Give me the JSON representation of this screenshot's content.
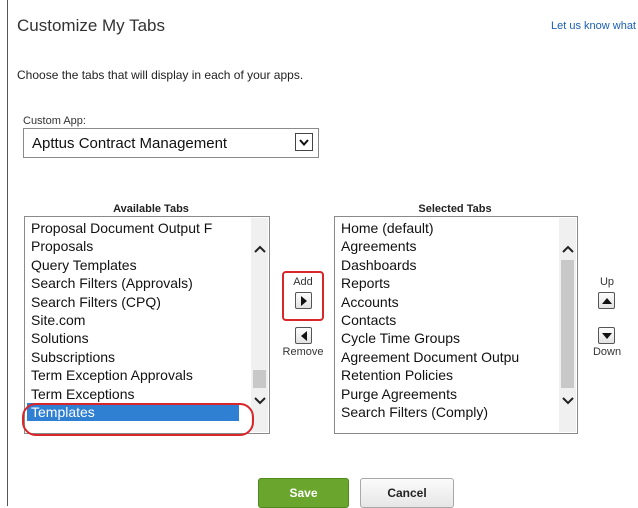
{
  "header": {
    "title": "Customize My Tabs",
    "feedback_link": "Let us know what"
  },
  "description": "Choose the tabs that will display in each of your apps.",
  "custom_app": {
    "label": "Custom App:",
    "selected": "Apttus Contract Management"
  },
  "available_tabs": {
    "heading": "Available Tabs",
    "items": [
      "Proposal Document Output F",
      "Proposals",
      "Query Templates",
      "Search Filters (Approvals)",
      "Search Filters (CPQ)",
      "Site.com",
      "Solutions",
      "Subscriptions",
      "Term Exception Approvals",
      "Term Exceptions",
      "Templates"
    ],
    "selected_item": "Templates"
  },
  "selected_tabs": {
    "heading": "Selected Tabs",
    "items": [
      "Home (default)",
      "Agreements",
      "Dashboards",
      "Reports",
      "Accounts",
      "Contacts",
      "Cycle Time Groups",
      "Agreement Document Outpu",
      "Retention Policies",
      "Purge Agreements",
      "Search Filters (Comply)"
    ]
  },
  "controls": {
    "add_label": "Add",
    "remove_label": "Remove",
    "up_label": "Up",
    "down_label": "Down"
  },
  "footer": {
    "save_label": "Save",
    "cancel_label": "Cancel"
  },
  "colors": {
    "highlight_red": "#d9262b",
    "save_green": "#6aa52e",
    "selection_blue": "#2f7fd3",
    "link_blue": "#1a5fb4"
  }
}
